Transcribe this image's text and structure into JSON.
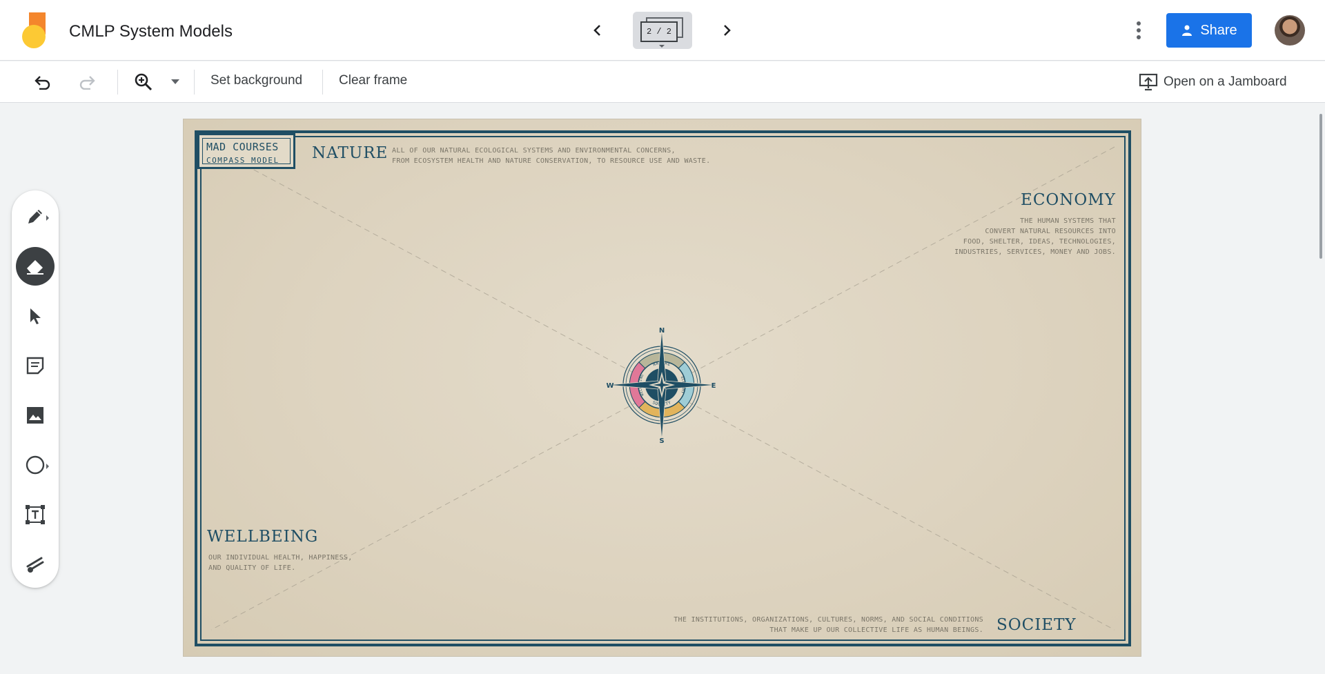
{
  "app": {
    "title": "CMLP System Models",
    "frame_indicator": "2 / 2",
    "share_label": "Share"
  },
  "toolbar": {
    "set_background": "Set background",
    "clear_frame": "Clear frame",
    "open_on_jamboard": "Open on a Jamboard"
  },
  "side_tools": [
    "pen-icon",
    "eraser-icon",
    "select-icon",
    "sticky-note-icon",
    "image-icon",
    "circle-icon",
    "text-box-icon",
    "laser-icon"
  ],
  "frame": {
    "brand_line1": "MAD COURSES",
    "brand_line2": "COMPASS MODEL",
    "nature": {
      "title": "NATURE",
      "desc1": "ALL OF OUR NATURAL ECOLOGICAL SYSTEMS AND ENVIRONMENTAL CONCERNS,",
      "desc2": "FROM ECOSYSTEM HEALTH AND NATURE CONSERVATION, TO RESOURCE USE AND WASTE."
    },
    "economy": {
      "title": "ECONOMY",
      "desc1": "THE HUMAN SYSTEMS THAT",
      "desc2": "CONVERT NATURAL RESOURCES INTO",
      "desc3": "FOOD, SHELTER, IDEAS, TECHNOLOGIES,",
      "desc4": "INDUSTRIES, SERVICES, MONEY AND JOBS."
    },
    "wellbeing": {
      "title": "WELLBEING",
      "desc1": "OUR INDIVIDUAL HEALTH, HAPPINESS,",
      "desc2": "AND QUALITY OF LIFE."
    },
    "society": {
      "title": "SOCIETY",
      "desc1": "THE INSTITUTIONS, ORGANIZATIONS, CULTURES, NORMS, AND SOCIAL CONDITIONS",
      "desc2": "THAT MAKE UP OUR COLLECTIVE LIFE AS HUMAN BEINGS."
    },
    "compass": {
      "n": "N",
      "e": "E",
      "s": "S",
      "w": "W",
      "ring_nature": "NATURE",
      "ring_society": "SOCIETY",
      "ring_economy": "ECONOMY",
      "ring_wellbeing": "WELLBEING",
      "colors": {
        "nature": "#b8b69a",
        "economy": "#9fcdd6",
        "society": "#e2b45c",
        "wellbeing": "#e07898",
        "ink": "#1f4e64"
      }
    }
  },
  "colors": {
    "accent": "#1a73e8",
    "frame_border": "#1f4e64",
    "canvas_bg": "#ddd3bf"
  }
}
